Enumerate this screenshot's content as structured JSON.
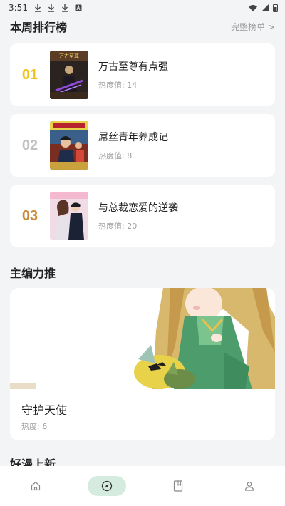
{
  "status_bar": {
    "time": "3:51"
  },
  "weekly_rank": {
    "title": "本周排行榜",
    "more": "完整榜单 >",
    "items": [
      {
        "no": "01",
        "no_color": "#f2c318",
        "title": "万古至尊有点强",
        "heat": "热度值: 14"
      },
      {
        "no": "02",
        "no_color": "#c2c2c2",
        "title": "屌丝青年养成记",
        "heat": "热度值: 8"
      },
      {
        "no": "03",
        "no_color": "#c98a3c",
        "title": "与总裁恋爱的逆袭",
        "heat": "热度值: 20"
      }
    ]
  },
  "editor_pick": {
    "title": "主编力推",
    "card": {
      "title": "守护天使",
      "heat": "热度: 6"
    }
  },
  "new_comics": {
    "title": "好漫上新"
  },
  "tabbar": {
    "tabs": [
      {
        "icon": "home-icon"
      },
      {
        "icon": "compass-icon",
        "active": true
      },
      {
        "icon": "bookmark-icon"
      },
      {
        "icon": "user-icon"
      }
    ]
  }
}
